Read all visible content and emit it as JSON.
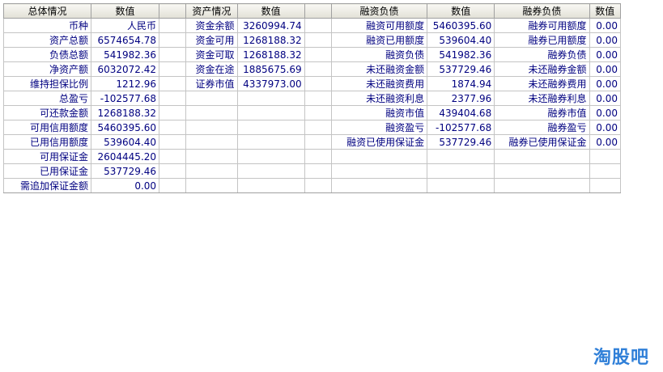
{
  "headers": [
    "总体情况",
    "数值",
    "",
    "资产情况",
    "数值",
    "",
    "融资负债",
    "数值",
    "融券负债",
    "数值"
  ],
  "rows": [
    [
      "币种",
      "人民币",
      "",
      "资金余额",
      "3260994.74",
      "",
      "融资可用额度",
      "5460395.60",
      "融券可用额度",
      "0.00"
    ],
    [
      "资产总额",
      "6574654.78",
      "",
      "资金可用",
      "1268188.32",
      "",
      "融资已用额度",
      "539604.40",
      "融券已用额度",
      "0.00"
    ],
    [
      "负债总额",
      "541982.36",
      "",
      "资金可取",
      "1268188.32",
      "",
      "融资负债",
      "541982.36",
      "融券负债",
      "0.00"
    ],
    [
      "净资产额",
      "6032072.42",
      "",
      "资金在途",
      "1885675.69",
      "",
      "未还融资金额",
      "537729.46",
      "未还融券金额",
      "0.00"
    ],
    [
      "维持担保比例",
      "1212.96",
      "",
      "证券市值",
      "4337973.00",
      "",
      "未还融资费用",
      "1874.94",
      "未还融券费用",
      "0.00"
    ],
    [
      "总盈亏",
      "-102577.68",
      "",
      "",
      "",
      "",
      "未还融资利息",
      "2377.96",
      "未还融券利息",
      "0.00"
    ],
    [
      "可还款金额",
      "1268188.32",
      "",
      "",
      "",
      "",
      "融资市值",
      "439404.68",
      "融券市值",
      "0.00"
    ],
    [
      "可用信用额度",
      "5460395.60",
      "",
      "",
      "",
      "",
      "融资盈亏",
      "-102577.68",
      "融券盈亏",
      "0.00"
    ],
    [
      "已用信用额度",
      "539604.40",
      "",
      "",
      "",
      "",
      "融资已使用保证金",
      "537729.46",
      "融券已使用保证金",
      "0.00"
    ],
    [
      "可用保证金",
      "2604445.20",
      "",
      "",
      "",
      "",
      "",
      "",
      "",
      ""
    ],
    [
      "已用保证金",
      "537729.46",
      "",
      "",
      "",
      "",
      "",
      "",
      "",
      ""
    ],
    [
      "需追加保证金额",
      "0.00",
      "",
      "",
      "",
      "",
      "",
      "",
      "",
      ""
    ]
  ],
  "watermark": "淘股吧",
  "colors": {
    "value_text": "#000080",
    "header_text": "#000000",
    "watermark": "#2f7fd8"
  }
}
